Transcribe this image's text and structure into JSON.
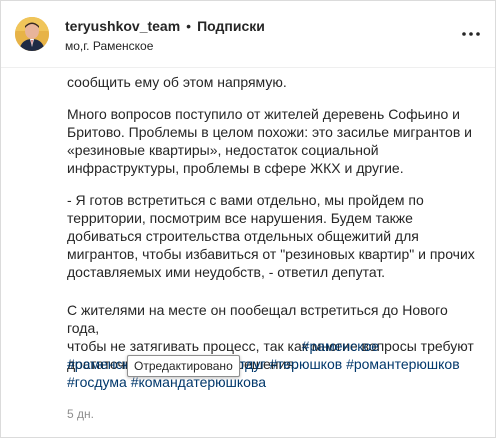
{
  "post": {
    "username": "teryushkov_team",
    "separator": "•",
    "follow_label": "Подписки",
    "location": "мо,г. Раменское",
    "timestamp": "5 дн."
  },
  "icons": {
    "avatar": "profile-photo",
    "more": "more-dots-icon"
  },
  "caption": {
    "paragraphs": [
      "сообщить ему об этом напрямую.",
      "Много вопросов поступило от жителей деревень Софьино и\nБритово. Проблемы в целом похожи: это засилье мигрантов и\n«резиновые квартиры», недостаток социальной\nинфраструктуры, проблемы в сфере ЖКХ и другие.",
      "- Я готов встретиться с вами отдельно, мы пройдем по\nтерритории, посмотрим все нарушения. Будем также\nдобиваться строительства отдельных общежитий для\nмигрантов, чтобы избавиться от \"резиновых квартир\" и прочих\nдоставляемых ими неудобств, - ответил депутат.",
      "С жителями на месте он пообещал встретиться до Нового года,\nчтобы не затягивать процесс, так как многие вопросы требуют\nдостаточно оперативного решения."
    ],
    "hashtags": [
      "#раменское",
      "#раменскоерайон",
      "#депутатдуг",
      "#терюшков",
      "#романтерюшков",
      "#госдума",
      "#командатерюшкова"
    ]
  },
  "tooltip": {
    "label": "Отредактировано"
  },
  "colors": {
    "text": "#262626",
    "hashtag": "#00376b",
    "muted": "#8e8e8e",
    "border": "#dbdbdb"
  }
}
